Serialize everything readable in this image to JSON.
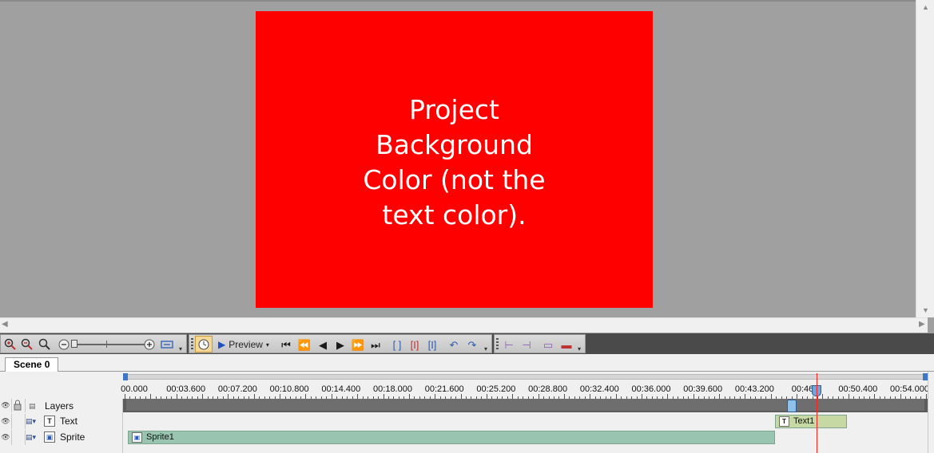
{
  "stage": {
    "background_color": "#a0a0a0",
    "canvas_color": "#ff0000",
    "canvas_text": "Project Background Color (not the text color)."
  },
  "toolbar": {
    "zoom_in_icon": "zoom-in-icon",
    "zoom_out_icon": "zoom-out-icon",
    "zoom_reset_icon": "zoom-100-icon",
    "fit_icon": "fit-range-icon",
    "clock_icon": "clock-icon",
    "preview_label": "Preview",
    "accent": "#2a5cb8"
  },
  "scene_tabs": [
    {
      "label": "Scene 0"
    }
  ],
  "timeline": {
    "tick_labels": [
      "00.000",
      "00:03.600",
      "00:07.200",
      "00:10.800",
      "00:14.400",
      "00:18.000",
      "00:21.600",
      "00:25.200",
      "00:28.800",
      "00:32.400",
      "00:36.000",
      "00:39.600",
      "00:43.200",
      "00:46.8",
      "00:50.400",
      "00:54.000"
    ],
    "header_label": "Layers",
    "playhead_color": "#ff2020",
    "layers": [
      {
        "name": "Text",
        "type_icon": "T",
        "clip_label": "Text1",
        "clip_color": "#c6d8a4"
      },
      {
        "name": "Sprite",
        "type_icon": "S",
        "clip_label": "Sprite1",
        "clip_color": "#98c4b0"
      }
    ]
  }
}
